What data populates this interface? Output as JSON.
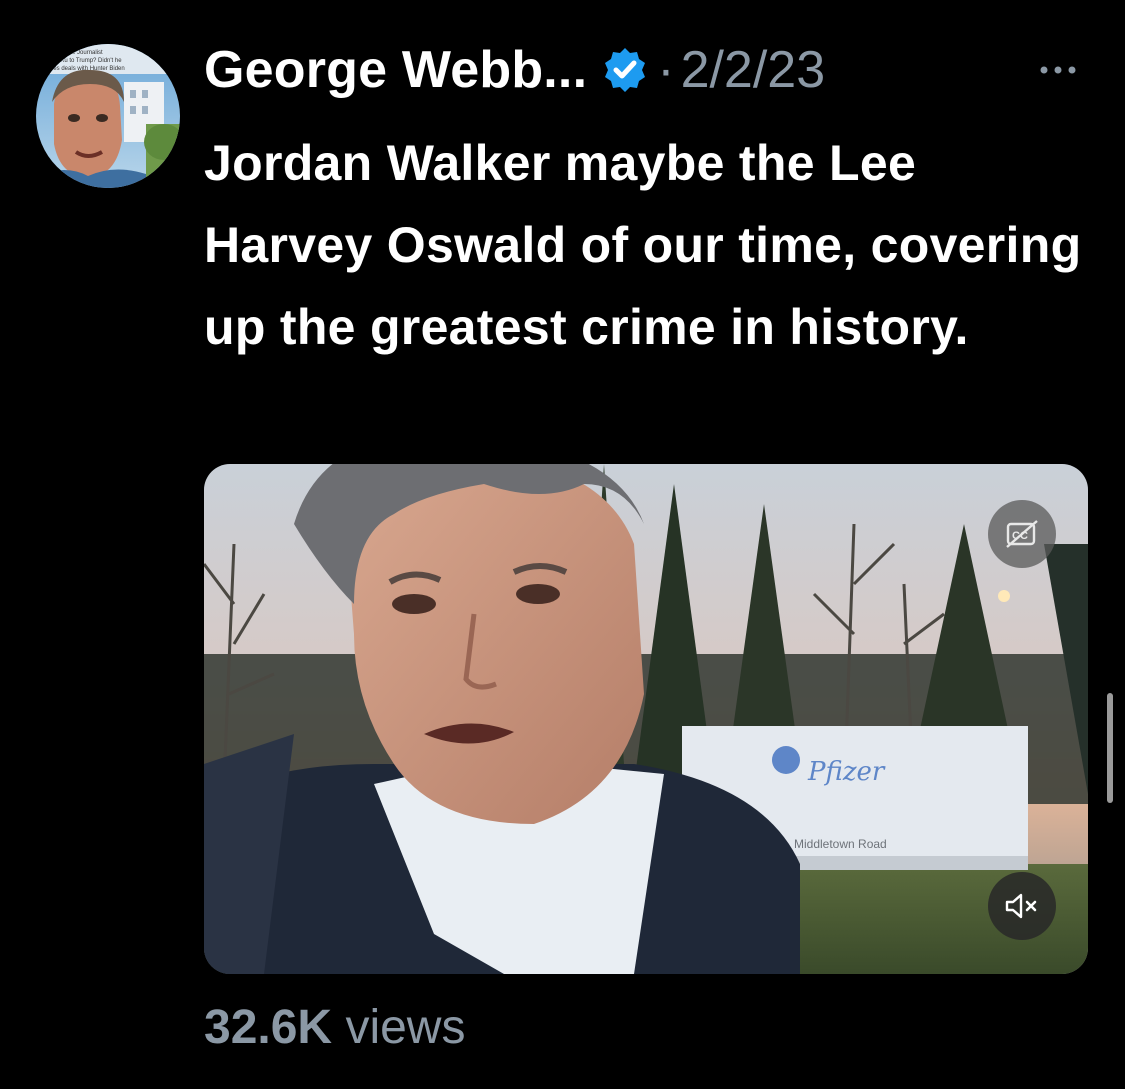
{
  "tweet": {
    "author_name": "George Webb...",
    "separator": "·",
    "timestamp": "2/2/23",
    "more_label": "···",
    "text": "Jordan Walker maybe the Lee Harvey Oswald of our time, covering up the greatest crime in history.",
    "views_count": "32.6K",
    "views_label": "views"
  },
  "avatar": {
    "headline_text": "Investigative Journalist ... one of Xu to Trump? Didn't he ... stones deals with Hunter Biden with his ..."
  },
  "media": {
    "sign_brand": "Pfizer",
    "sign_address": "Middletown Road",
    "cc_icon": "cc-icon",
    "mute_icon": "speaker-muted-icon"
  },
  "colors": {
    "background": "#000000",
    "text_primary": "#ffffff",
    "text_secondary": "#8b98a5",
    "verified_badge": "#1d9bf0"
  }
}
